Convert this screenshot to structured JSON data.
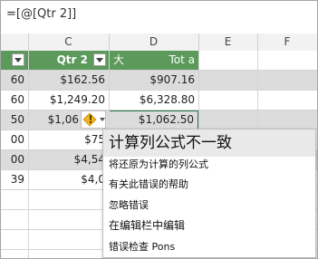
{
  "formula_bar": {
    "text": "=[@[Qtr 2]]"
  },
  "columns": [
    "C",
    "D",
    "E",
    "F"
  ],
  "table_header": {
    "qtr2": "Qtr 2",
    "tot_prefix": "大",
    "tot": "Tot a"
  },
  "rows": [
    {
      "b": "60",
      "c": "$162.56",
      "d": "$907.16"
    },
    {
      "b": "60",
      "c": "$1,249.20",
      "d": "$6,328.80"
    },
    {
      "b": "50",
      "c": "$1,06",
      "d": "$1,062.50"
    },
    {
      "b": "00",
      "c": "$75",
      "d": ""
    },
    {
      "b": "00",
      "c": "$4,54",
      "d": ""
    },
    {
      "b": "39",
      "c": "$4,0",
      "d": ""
    }
  ],
  "error_button": {
    "icon": "warning-icon",
    "symbol": "!"
  },
  "error_menu": {
    "title": "计算列公式不一致",
    "items": [
      "将还原为计算的列公式",
      "有关此错误的帮助",
      "忽略错误",
      "在编辑栏中编辑",
      "错误检查 Pons"
    ]
  },
  "colors": {
    "header_green": "#5b9a5a",
    "band": "#dcdcdc",
    "selected_cell_border": "#217346"
  }
}
